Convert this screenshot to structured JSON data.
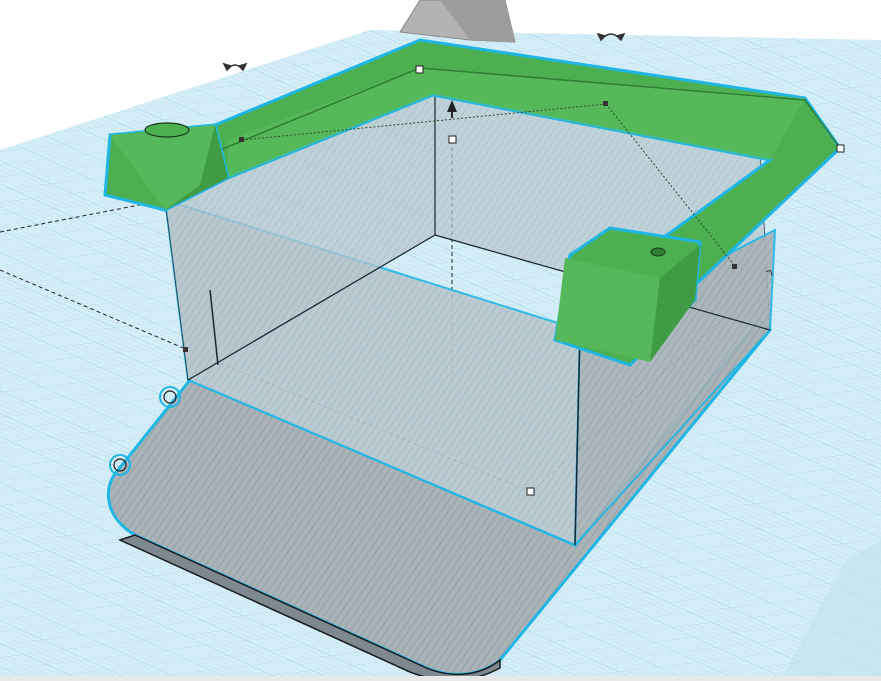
{
  "viewport": {
    "background_color": "#ffffff",
    "workplane_color": "#d3ecf6",
    "grid_color": "#9fd4e8",
    "selection_outline_color": "#1fb6e6"
  },
  "workplane": {
    "type": "grid",
    "visible": true
  },
  "shapes": [
    {
      "name": "box-base",
      "color": "#9a9fa3",
      "mode": "hole",
      "selected": true
    },
    {
      "name": "green-rim",
      "color": "#4caf50",
      "mode": "solid",
      "selected": true
    },
    {
      "name": "left-peg",
      "color": "#4caf50",
      "mode": "solid",
      "selected": true
    },
    {
      "name": "right-peg",
      "color": "#4caf50",
      "mode": "solid",
      "selected": true
    },
    {
      "name": "back-gray-wedge",
      "color": "#a8a8a8",
      "mode": "solid",
      "selected": false
    }
  ],
  "handles": {
    "rotate_handles": [
      "rotate-arrow-icon",
      "rotate-arrow-icon"
    ],
    "height_handle": "height-arrow-icon",
    "scale_handles": 4,
    "midpoint_handles": 4
  }
}
